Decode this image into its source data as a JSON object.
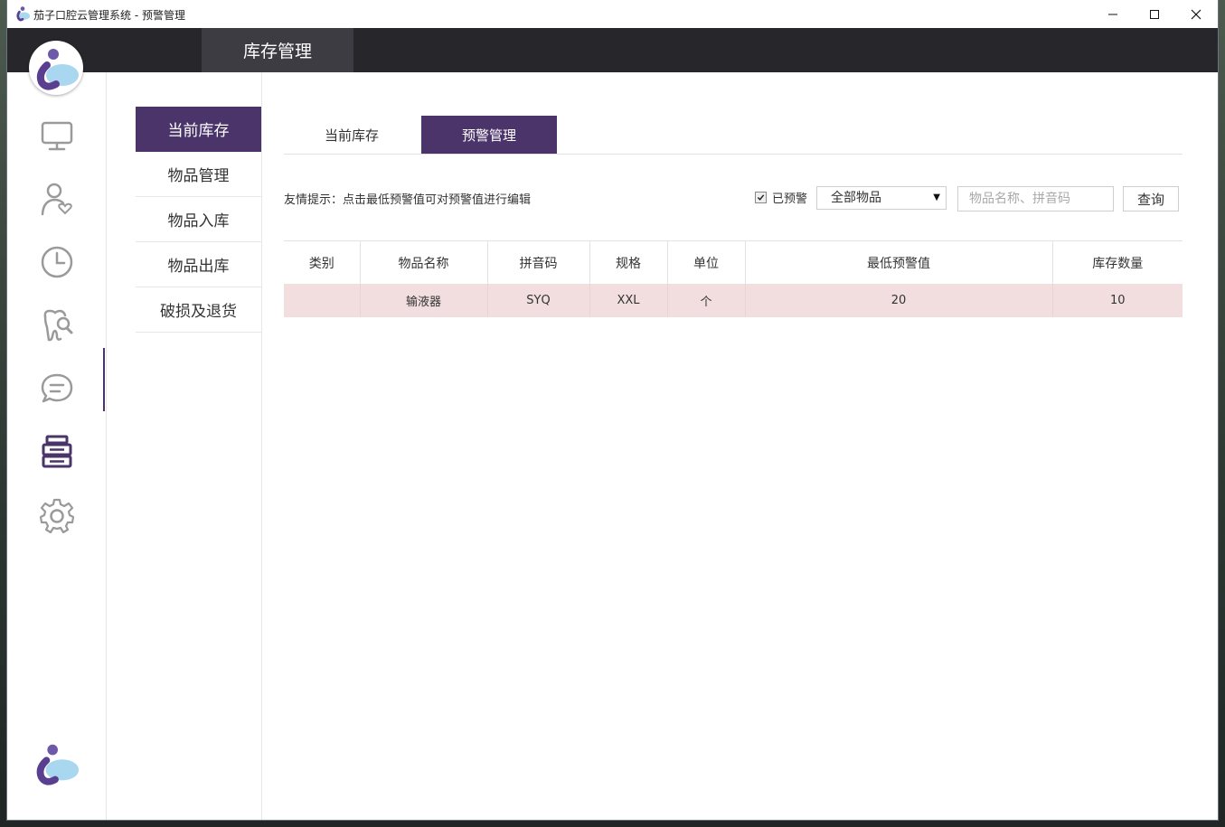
{
  "window": {
    "title": "茄子口腔云管理系统 - 预警管理",
    "controls": [
      "minimize-icon",
      "maximize-icon",
      "close-icon"
    ]
  },
  "header": {
    "module_title": "库存管理"
  },
  "rail": {
    "items": [
      "monitor-icon",
      "patient-icon",
      "clock-icon",
      "tooth-search-icon",
      "chat-icon",
      "inventory-icon",
      "settings-icon"
    ],
    "active": "inventory-icon"
  },
  "submenu": {
    "items": [
      {
        "label": "当前库存",
        "active": true
      },
      {
        "label": "物品管理",
        "active": false
      },
      {
        "label": "物品入库",
        "active": false
      },
      {
        "label": "物品出库",
        "active": false
      },
      {
        "label": "破损及退货",
        "active": false
      }
    ]
  },
  "tabs": [
    {
      "label": "当前库存",
      "active": false
    },
    {
      "label": "预警管理",
      "active": true
    }
  ],
  "toolbar": {
    "hint": "友情提示：点击最低预警值可对预警值进行编辑",
    "checkbox_label": "已预警",
    "checkbox_checked": true,
    "category_selected": "全部物品",
    "search_placeholder": "物品名称、拼音码",
    "query_label": "查询"
  },
  "table": {
    "columns": [
      "类别",
      "物品名称",
      "拼音码",
      "规格",
      "单位",
      "最低预警值",
      "库存数量"
    ],
    "rows": [
      [
        "",
        "输液器",
        "SYQ",
        "XXL",
        "个",
        "20",
        "10"
      ]
    ]
  },
  "colors": {
    "accent": "#4a3469",
    "header_bg": "#27272b",
    "warning_row": "#f2dede"
  }
}
